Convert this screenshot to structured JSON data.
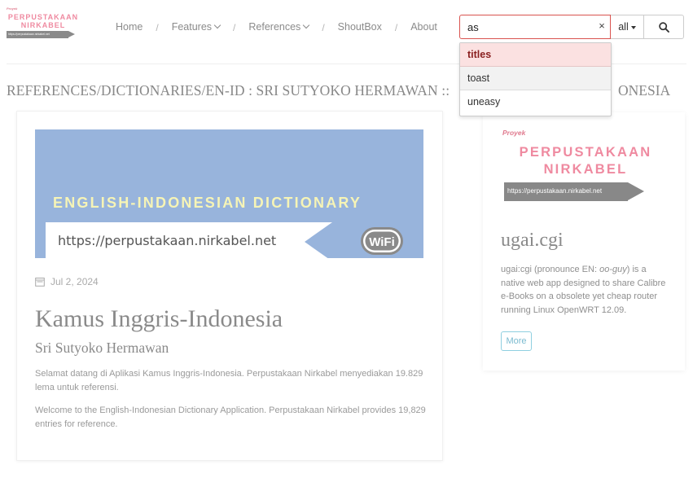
{
  "logo": {
    "proyek": "Proyek",
    "name_line1": "PERPUSTAKAAN",
    "name_line2": "NIRKABEL",
    "url": "https://perpustakaan.nirkabel.net"
  },
  "nav": {
    "home": "Home",
    "features": "Features",
    "references": "References",
    "shoutbox": "ShoutBox",
    "about": "About",
    "separator": "/"
  },
  "search": {
    "value": "as",
    "clear": "×",
    "scope": "all",
    "suggestions": [
      "titles",
      "toast",
      "uneasy"
    ]
  },
  "page_title": "REFERENCES/DICTIONARIES/EN-ID : SRI SUTYOKO HERMAWAN ::",
  "page_title_tail": "ONESIA",
  "main": {
    "banner_title": "ENGLISH-INDONESIAN DICTIONARY",
    "banner_url": "https://perpustakaan.nirkabel.net",
    "banner_badge": "WiFi",
    "date": "Jul 2, 2024",
    "title": "Kamus Inggris-Indonesia",
    "subtitle": "Sri Sutyoko Hermawan",
    "paragraph_id": "Selamat datang di Aplikasi Kamus Inggris-Indonesia. Perpustakaan Nirkabel menyediakan 19.829 lema untuk referensi.",
    "paragraph_en": "Welcome to the English-Indonesian Dictionary Application. Perpustakaan Nirkabel provides 19,829 entries for reference."
  },
  "side": {
    "logo_proyek": "Proyek",
    "logo_line1": "PERPUSTAKAAN",
    "logo_line2": "NIRKABEL",
    "logo_url": "https://perpustakaan.nirkabel.net",
    "title": "ugai.cgi",
    "desc_prefix": "ugai:cgi (pronounce EN: ",
    "desc_em": "oo-guy",
    "desc_suffix": ") is a native web app designed to share Calibre e-Books on a obsolete yet cheap router running Linux OpenWRT 12.09.",
    "more": "More"
  },
  "colors": {
    "accent_red": "#d9534f",
    "brand_pink": "#ef8aa0",
    "banner_blue": "#98b4dc",
    "more_blue": "#8fcfe0"
  }
}
